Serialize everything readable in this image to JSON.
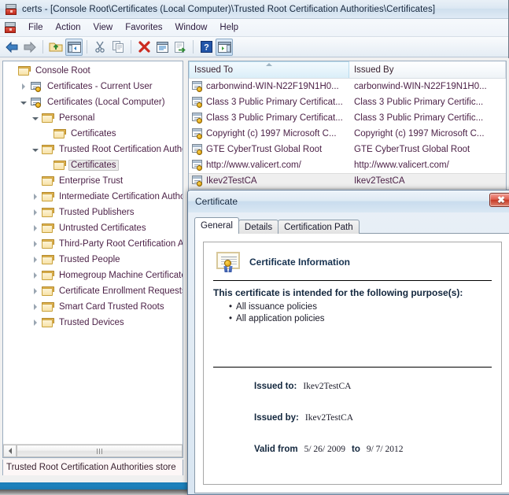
{
  "window": {
    "title": "certs - [Console Root\\Certificates (Local Computer)\\Trusted Root Certification Authorities\\Certificates]",
    "app_icon": "mmc-console-icon"
  },
  "menubar": {
    "items": [
      {
        "label": "File"
      },
      {
        "label": "Action"
      },
      {
        "label": "View"
      },
      {
        "label": "Favorites"
      },
      {
        "label": "Window"
      },
      {
        "label": "Help"
      }
    ]
  },
  "toolbar": {
    "buttons": [
      {
        "name": "back-icon",
        "glyph": "←",
        "color": "#2f6fb5",
        "pressed": false
      },
      {
        "name": "forward-icon",
        "glyph": "→",
        "color": "#9aa3ac",
        "pressed": false
      },
      {
        "name": "up-folder-icon",
        "glyph": "↑",
        "color": "#d8b551",
        "pressed": false
      },
      {
        "name": "show-hide-console-tree-icon",
        "glyph": "▤",
        "color": "#4a7fb5",
        "pressed": true
      },
      {
        "name": "cut-icon",
        "glyph": "✂",
        "color": "#6f8aa8",
        "pressed": false
      },
      {
        "name": "copy-icon",
        "glyph": "⧉",
        "color": "#8a9bb0",
        "pressed": false
      },
      {
        "name": "delete-icon",
        "glyph": "✖",
        "color": "#cc2b20",
        "pressed": false
      },
      {
        "name": "properties-icon",
        "glyph": "▤",
        "color": "#6f8aa8",
        "pressed": false
      },
      {
        "name": "export-list-icon",
        "glyph": "➡",
        "color": "#3f9e3f",
        "pressed": false
      },
      {
        "name": "help-icon",
        "glyph": "?",
        "color": "#2255a8",
        "pressed": false
      },
      {
        "name": "show-action-pane-icon",
        "glyph": "▶",
        "color": "#3f9e3f",
        "pressed": true
      }
    ]
  },
  "tree": {
    "items": [
      {
        "label": "Console Root",
        "indent": 0,
        "expander": "none",
        "icon": "folder-icon",
        "selected": false
      },
      {
        "label": "Certificates - Current User",
        "indent": 1,
        "expander": "closed",
        "icon": "store-icon",
        "selected": false
      },
      {
        "label": "Certificates (Local Computer)",
        "indent": 1,
        "expander": "open",
        "icon": "store-icon",
        "selected": false
      },
      {
        "label": "Personal",
        "indent": 2,
        "expander": "open",
        "icon": "folder-icon",
        "selected": false
      },
      {
        "label": "Certificates",
        "indent": 3,
        "expander": "none",
        "icon": "folder-icon",
        "selected": false
      },
      {
        "label": "Trusted Root Certification Authorities",
        "indent": 2,
        "expander": "open",
        "icon": "folder-icon",
        "selected": false
      },
      {
        "label": "Certificates",
        "indent": 3,
        "expander": "none",
        "icon": "folder-icon",
        "selected": true
      },
      {
        "label": "Enterprise Trust",
        "indent": 2,
        "expander": "none",
        "icon": "folder-icon",
        "selected": false
      },
      {
        "label": "Intermediate Certification Authorities",
        "indent": 2,
        "expander": "closed",
        "icon": "folder-icon",
        "selected": false
      },
      {
        "label": "Trusted Publishers",
        "indent": 2,
        "expander": "closed",
        "icon": "folder-icon",
        "selected": false
      },
      {
        "label": "Untrusted Certificates",
        "indent": 2,
        "expander": "closed",
        "icon": "folder-icon",
        "selected": false
      },
      {
        "label": "Third-Party Root Certification Authorities",
        "indent": 2,
        "expander": "closed",
        "icon": "folder-icon",
        "selected": false
      },
      {
        "label": "Trusted People",
        "indent": 2,
        "expander": "closed",
        "icon": "folder-icon",
        "selected": false
      },
      {
        "label": "Homegroup Machine Certificates",
        "indent": 2,
        "expander": "closed",
        "icon": "folder-icon",
        "selected": false
      },
      {
        "label": "Certificate Enrollment Requests",
        "indent": 2,
        "expander": "closed",
        "icon": "folder-icon",
        "selected": false
      },
      {
        "label": "Smart Card Trusted Roots",
        "indent": 2,
        "expander": "closed",
        "icon": "folder-icon",
        "selected": false
      },
      {
        "label": "Trusted Devices",
        "indent": 2,
        "expander": "closed",
        "icon": "folder-icon",
        "selected": false
      }
    ],
    "status_text": "Trusted Root Certification Authorities store"
  },
  "list": {
    "columns": [
      {
        "label": "Issued To",
        "sorted": true,
        "sort_dir": "asc"
      },
      {
        "label": "Issued By",
        "sorted": false,
        "sort_dir": ""
      }
    ],
    "rows": [
      {
        "issued_to": "carbonwind-WIN-N22F19N1H0...",
        "issued_by": "carbonwind-WIN-N22F19N1H0...",
        "selected": false
      },
      {
        "issued_to": "Class 3 Public Primary Certificat...",
        "issued_by": "Class 3 Public Primary Certific...",
        "selected": false
      },
      {
        "issued_to": "Class 3 Public Primary Certificat...",
        "issued_by": "Class 3 Public Primary Certific...",
        "selected": false
      },
      {
        "issued_to": "Copyright (c) 1997 Microsoft C...",
        "issued_by": "Copyright (c) 1997 Microsoft C...",
        "selected": false
      },
      {
        "issued_to": "GTE CyberTrust Global Root",
        "issued_by": "GTE CyberTrust Global Root",
        "selected": false
      },
      {
        "issued_to": "http://www.valicert.com/",
        "issued_by": "http://www.valicert.com/",
        "selected": false
      },
      {
        "issued_to": "Ikev2TestCA",
        "issued_by": "Ikev2TestCA",
        "selected": true
      }
    ]
  },
  "dialog": {
    "title": "Certificate",
    "close_label": "✖",
    "tabs": [
      {
        "label": "General",
        "active": true
      },
      {
        "label": "Details",
        "active": false
      },
      {
        "label": "Certification Path",
        "active": false
      }
    ],
    "general": {
      "heading": "Certificate Information",
      "purpose_title": "This certificate is intended for the following purpose(s):",
      "purposes": [
        "All issuance policies",
        "All application policies"
      ],
      "fields": [
        {
          "label": "Issued to:",
          "value": "Ikev2TestCA"
        },
        {
          "label": "Issued by:",
          "value": "Ikev2TestCA"
        }
      ],
      "valid": {
        "label": "Valid from",
        "from": "5/ 26/ 2009",
        "sep": "to",
        "until": "9/ 7/ 2012"
      }
    }
  },
  "colors": {
    "accent_blue": "#2f6fb5",
    "title_text": "#16263c",
    "tree_text": "#4a1f45",
    "taskbar": "#1d82bd",
    "close_red": "#c63b27"
  }
}
